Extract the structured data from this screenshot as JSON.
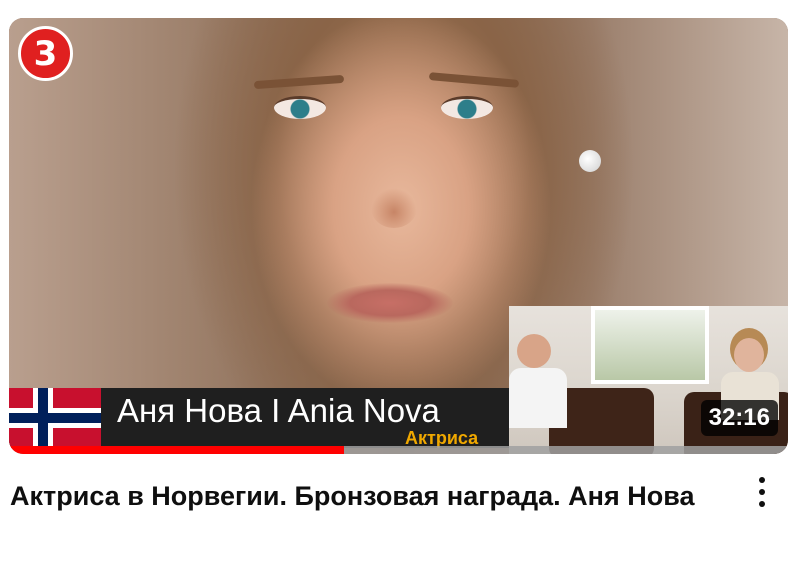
{
  "video": {
    "channel_badge": "3",
    "overlay_name": "Аня Нова I Ania Nova",
    "overlay_role": "Актриса",
    "duration": "32:16",
    "watch_progress_percent": 43,
    "title": "Актриса в Норвегии. Бронзовая награда. Аня Нова"
  },
  "icons": {
    "flag": "norway-flag-icon",
    "menu": "more-vert-icon"
  },
  "colors": {
    "progress": "#ff0000",
    "badge": "#e02020",
    "role_text": "#f0a800"
  }
}
